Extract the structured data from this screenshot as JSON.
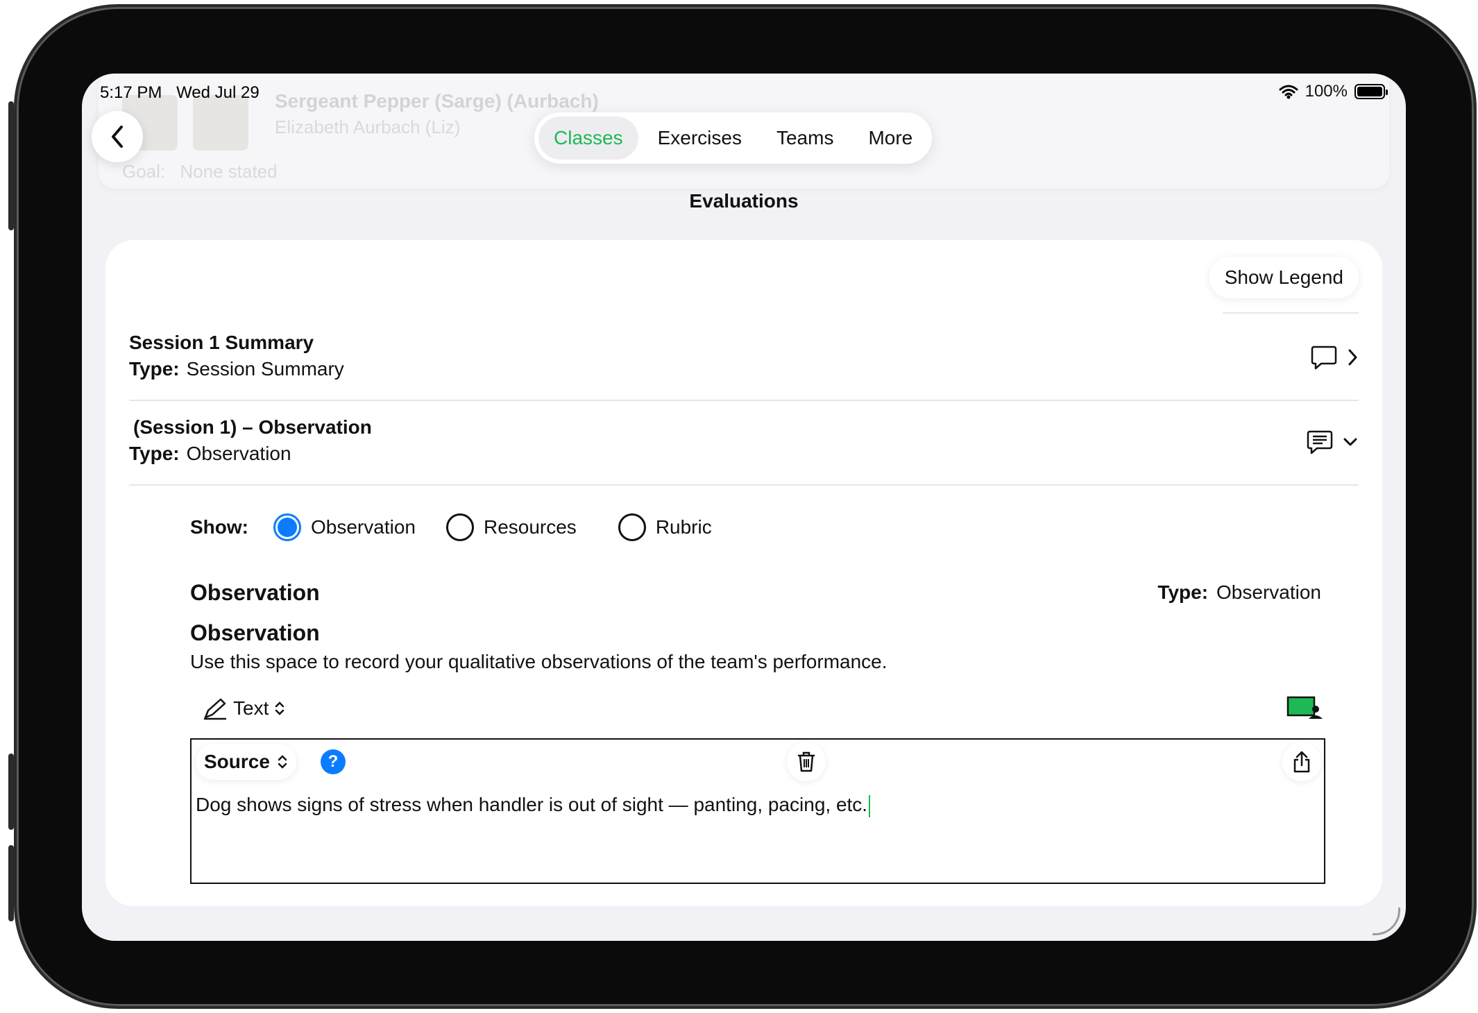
{
  "status": {
    "time": "5:17 PM",
    "date": "Wed Jul 29",
    "battery": "100%"
  },
  "ghost": {
    "name": "Sergeant Pepper (Sarge) (Aurbach)",
    "handler": "Elizabeth Aurbach  (Liz)",
    "goal_label": "Goal:",
    "goal_value": "None stated"
  },
  "tabs": [
    {
      "label": "Classes",
      "active": true
    },
    {
      "label": "Exercises"
    },
    {
      "label": "Teams"
    },
    {
      "label": "More"
    }
  ],
  "page_title": "Evaluations",
  "legend_button": "Show Legend",
  "rows": [
    {
      "title": "Session 1 Summary",
      "type_label": "Type:",
      "type_value": "Session Summary"
    },
    {
      "title": "(Session 1) – Observation",
      "type_label": "Type:",
      "type_value": "Observation"
    }
  ],
  "show": {
    "label": "Show:",
    "options": [
      "Observation",
      "Resources",
      "Rubric"
    ],
    "selected": "Observation"
  },
  "observation": {
    "heading": "Observation",
    "type_label": "Type:",
    "type_value": "Observation",
    "sub_heading": "Observation",
    "description": "Use this space to record your qualitative observations of the team's performance.",
    "mode": "Text"
  },
  "editor": {
    "source_label": "Source",
    "help": "?",
    "content": "Dog shows signs of stress when handler is out of sight — panting, pacing, etc."
  },
  "colors": {
    "accent_green": "#1db954",
    "blue": "#0a7cff"
  }
}
